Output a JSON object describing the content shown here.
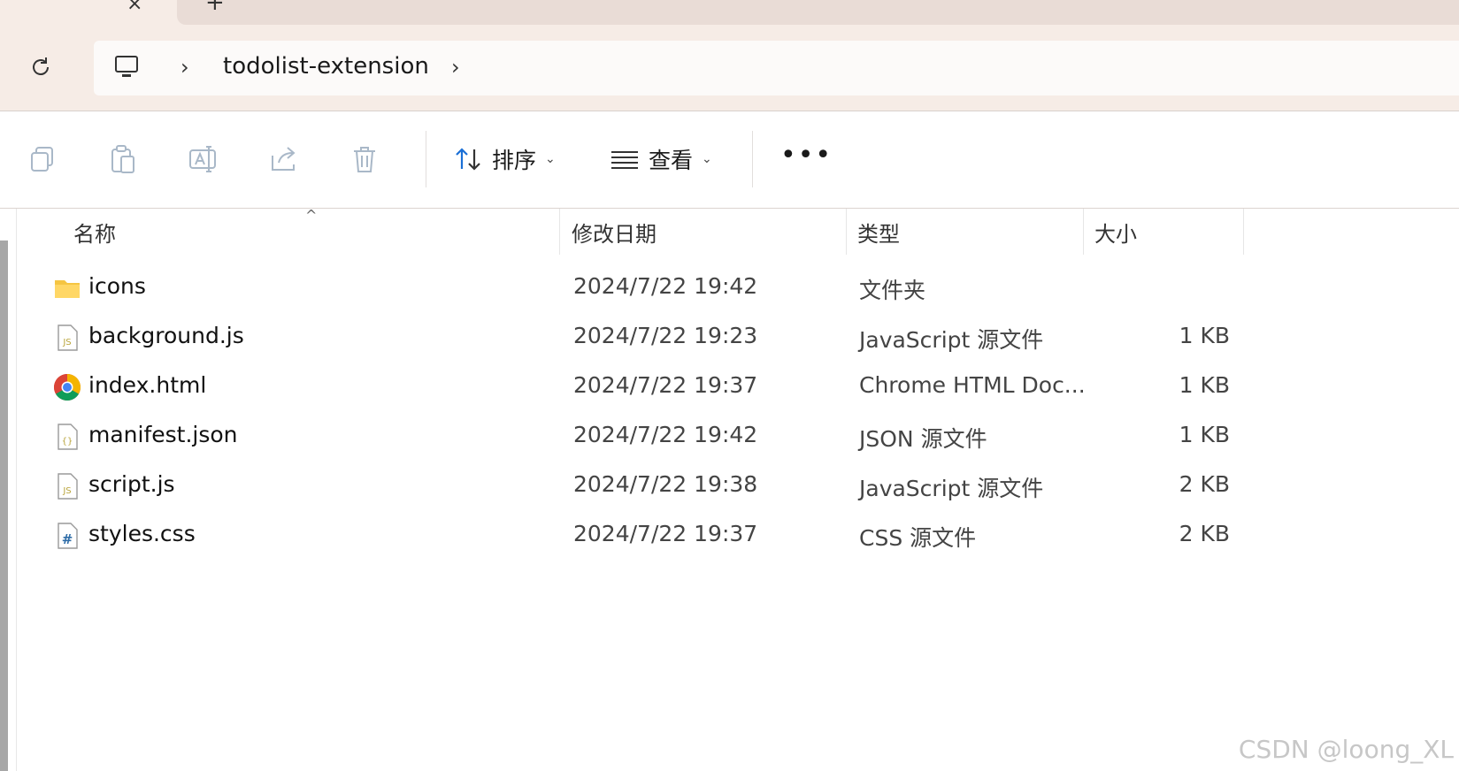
{
  "window": {
    "close_glyph": "×",
    "new_tab_glyph": "+"
  },
  "address": {
    "refresh_icon": "refresh-icon",
    "root_icon": "this-pc-icon",
    "separator": "›",
    "folder": "todolist-extension"
  },
  "toolbar": {
    "copy_icon": "copy-icon",
    "paste_icon": "paste-icon",
    "rename_icon": "rename-icon",
    "share_icon": "share-icon",
    "delete_icon": "delete-icon",
    "sort_label": "排序",
    "view_label": "查看",
    "more_label": "•••",
    "chevron": "⌄"
  },
  "columns": {
    "name": "名称",
    "modified": "修改日期",
    "type": "类型",
    "size": "大小",
    "sort_indicator": "^"
  },
  "files": [
    {
      "icon": "folder-icon",
      "name": "icons",
      "modified": "2024/7/22 19:42",
      "type": "文件夹",
      "size": ""
    },
    {
      "icon": "js-file-icon",
      "name": "background.js",
      "modified": "2024/7/22 19:23",
      "type": "JavaScript 源文件",
      "size": "1 KB"
    },
    {
      "icon": "chrome-html-icon",
      "name": "index.html",
      "modified": "2024/7/22 19:37",
      "type": "Chrome HTML Doc...",
      "size": "1 KB"
    },
    {
      "icon": "json-file-icon",
      "name": "manifest.json",
      "modified": "2024/7/22 19:42",
      "type": "JSON 源文件",
      "size": "1 KB"
    },
    {
      "icon": "js-file-icon",
      "name": "script.js",
      "modified": "2024/7/22 19:38",
      "type": "JavaScript 源文件",
      "size": "2 KB"
    },
    {
      "icon": "css-file-icon",
      "name": "styles.css",
      "modified": "2024/7/22 19:37",
      "type": "CSS 源文件",
      "size": "2 KB"
    }
  ],
  "watermark": "CSDN @loong_XL",
  "colors": {
    "chrome_bg": "#f6ece6",
    "accent_blue": "#1a6fd6",
    "folder_yellow": "#f5c542"
  }
}
